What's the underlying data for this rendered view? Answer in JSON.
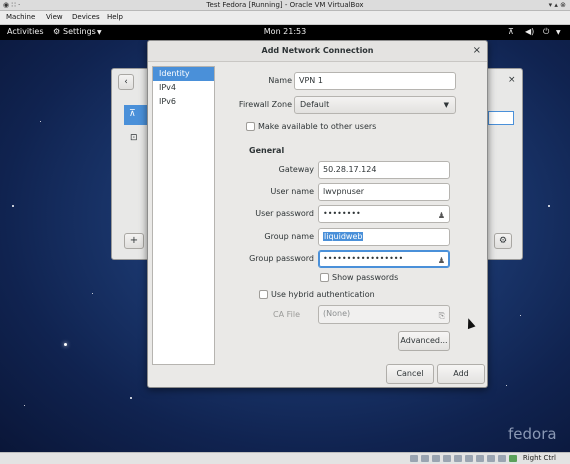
{
  "host": {
    "title": "Test Fedora [Running] - Oracle VM VirtualBox",
    "menu": [
      "Machine",
      "View",
      "Devices",
      "Help"
    ],
    "hostkey": "Right Ctrl"
  },
  "gnome": {
    "activities": "Activities",
    "app_menu": "Settings",
    "clock": "Mon 21:53",
    "watermark": "fedora"
  },
  "dialog": {
    "title": "Add Network Connection",
    "close": "×",
    "sidebar": [
      "Identity",
      "IPv4",
      "IPv6"
    ],
    "name_label": "Name",
    "name_value": "VPN 1",
    "firewall_label": "Firewall Zone",
    "firewall_value": "Default",
    "available_label": "Make available to other users",
    "general_heading": "General",
    "gateway_label": "Gateway",
    "gateway_value": "50.28.17.124",
    "username_label": "User name",
    "username_value": "lwvpnuser",
    "userpass_label": "User password",
    "userpass_value": "••••••••",
    "groupname_label": "Group name",
    "groupname_value": "liquidweb",
    "grouppass_label": "Group password",
    "grouppass_value": "•••••••••••••••••",
    "show_passwords": "Show passwords",
    "hybrid_label": "Use hybrid authentication",
    "cafile_label": "CA File",
    "cafile_value": "(None)",
    "advanced": "Advanced...",
    "cancel": "Cancel",
    "add": "Add"
  },
  "colors": {
    "accent": "#4a90d9",
    "topbar": "#000000",
    "desktop": "#1c3a72"
  }
}
